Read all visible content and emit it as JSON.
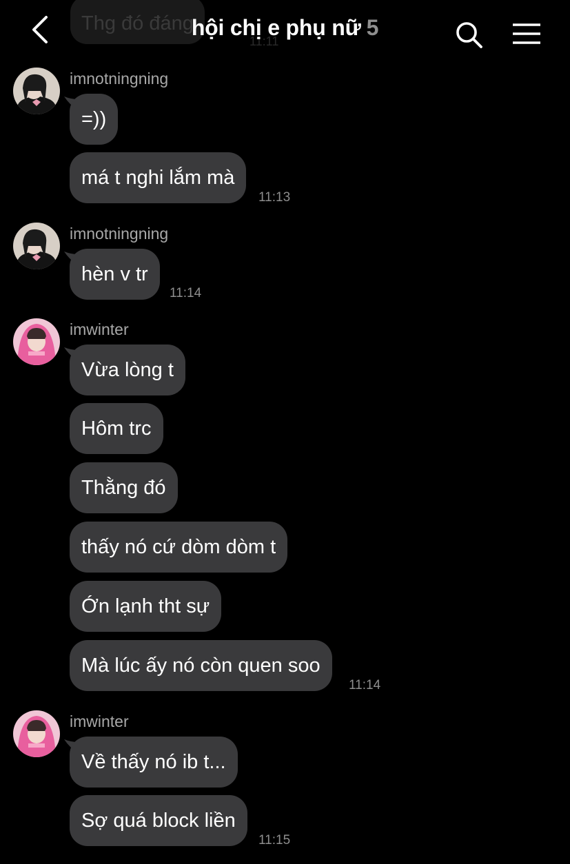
{
  "header": {
    "title": "hội chị e phụ nữ",
    "member_count": "5",
    "prev_message_text": "Thg đó đáng",
    "prev_message_time": "11:11",
    "back_icon": "chevron-left-icon",
    "search_icon": "search-icon",
    "menu_icon": "hamburger-menu-icon"
  },
  "groups": [
    {
      "sender": "imnotningning",
      "avatar": "avatar-photo",
      "messages": [
        "=))",
        "má t nghi lắm mà"
      ],
      "time": "11:13"
    },
    {
      "sender": "imnotningning",
      "avatar": "avatar-photo",
      "messages": [
        "hèn v tr"
      ],
      "time": "11:14"
    },
    {
      "sender": "imwinter",
      "avatar": "avatar-photo",
      "messages": [
        "Vừa lòng t",
        "Hôm trc",
        "Thằng đó",
        "thấy nó cứ dòm dòm t",
        "Ớn lạnh tht sự",
        "Mà lúc ấy nó còn quen soo"
      ],
      "time": "11:14"
    },
    {
      "sender": "imwinter",
      "avatar": "avatar-photo",
      "messages": [
        "Về thấy nó ib t...",
        "Sợ quá block liền"
      ],
      "time": "11:15"
    }
  ],
  "colors": {
    "background": "#000000",
    "bubble": "#3a3a3c",
    "sender_text": "#a8a8a8",
    "time_text": "#8e8e8e"
  }
}
